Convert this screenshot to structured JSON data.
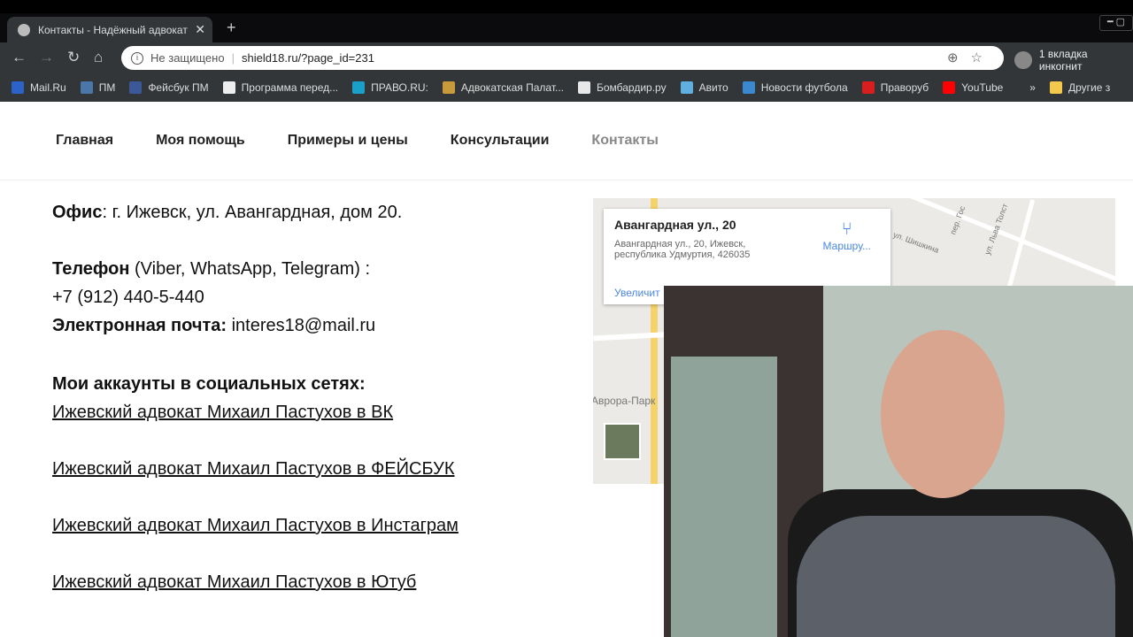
{
  "browser": {
    "tab_title": "Контакты - Надёжный адвокат",
    "security": "Не защищено",
    "url": "shield18.ru/?page_id=231",
    "incognito": "1 вкладка инкогнит",
    "bookmarks": [
      {
        "label": "Mail.Ru",
        "color": "#2b63c9"
      },
      {
        "label": "ПМ",
        "color": "#4a76a8"
      },
      {
        "label": "Фейсбук ПМ",
        "color": "#3b5998"
      },
      {
        "label": "Программа перед...",
        "color": "#eeeeee"
      },
      {
        "label": "ПРАВО.RU:",
        "color": "#1aa0c8"
      },
      {
        "label": "Адвокатская Палат...",
        "color": "#c89a3a"
      },
      {
        "label": "Бомбардир.ру",
        "color": "#e8e8e8"
      },
      {
        "label": "Авито",
        "color": "#5fb0e0"
      },
      {
        "label": "Новости футбола",
        "color": "#3a88d0"
      },
      {
        "label": "Праворуб",
        "color": "#d81e1e"
      },
      {
        "label": "YouTube",
        "color": "#ff0000"
      }
    ],
    "more": "»",
    "other": "Другие з"
  },
  "nav": [
    "Главная",
    "Моя помощь",
    "Примеры и цены",
    "Консультации",
    "Контакты"
  ],
  "contacts": {
    "office_label": "Офис",
    "office": ": г. Ижевск, ул. Авангардная, дом 20.",
    "phone_label": "Телефон",
    "phone_note": " (Viber, WhatsApp, Telegram) :",
    "phone": "+7 (912) 440-5-440",
    "email_label": "Электронная почта:",
    "email": " interes18@mail.ru",
    "social_heading": "Мои аккаунты в социальных сетях:",
    "links": [
      "Ижевский адвокат Михаил Пастухов в ВК",
      "Ижевский адвокат Михаил Пастухов в ФЕЙСБУК",
      "Ижевский адвокат Михаил Пастухов в Инстаграм",
      "Ижевский адвокат Михаил Пастухов в Ютуб"
    ]
  },
  "map": {
    "title": "Авангардная ул., 20",
    "address1": "Авангардная ул., 20, Ижевск,",
    "address2": "республика Удмуртия, 426035",
    "route": "Маршру...",
    "enlarge": "Увеличит",
    "labels": [
      "ул. Шишкина",
      "ул. Льва Толст",
      "пер. Гос",
      "Аврора-Парк"
    ]
  }
}
